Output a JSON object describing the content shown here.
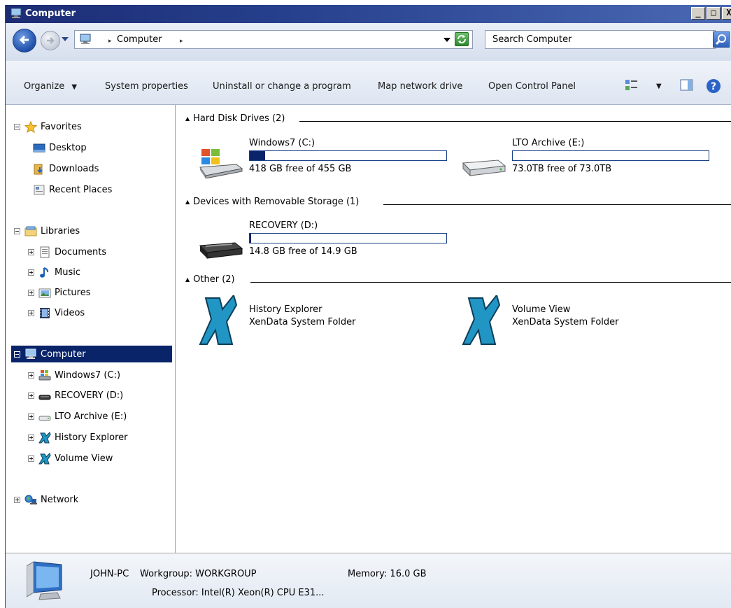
{
  "window": {
    "title": "Computer"
  },
  "title_buttons": {
    "minimize": "_",
    "maximize": "□",
    "close": "X"
  },
  "address": {
    "location": "Computer",
    "search_placeholder": "Search Computer"
  },
  "toolbar": {
    "organize": "Organize",
    "system_properties": "System properties",
    "uninstall": "Uninstall or change a program",
    "map_drive": "Map network drive",
    "control_panel": "Open Control Panel"
  },
  "nav": {
    "favorites": {
      "label": "Favorites",
      "items": [
        "Desktop",
        "Downloads",
        "Recent Places"
      ]
    },
    "libraries": {
      "label": "Libraries",
      "items": [
        "Documents",
        "Music",
        "Pictures",
        "Videos"
      ]
    },
    "computer": {
      "label": "Computer",
      "items": [
        "Windows7 (C:)",
        "RECOVERY (D:)",
        "LTO Archive (E:)",
        "History Explorer",
        "Volume View"
      ]
    },
    "network": {
      "label": "Network"
    }
  },
  "groups": {
    "hdd": {
      "header": "Hard Disk Drives (2)",
      "drives": [
        {
          "name": "Windows7 (C:)",
          "free": "418 GB free of 455 GB",
          "used_fraction": 0.08
        },
        {
          "name": "LTO Archive (E:)",
          "free": "73.0TB free of 73.0TB",
          "used_fraction": 0.0
        }
      ]
    },
    "removable": {
      "header": "Devices with Removable Storage (1)",
      "drives": [
        {
          "name": "RECOVERY (D:)",
          "free": "14.8 GB free of 14.9 GB",
          "used_fraction": 0.007
        }
      ]
    },
    "other": {
      "header": "Other (2)",
      "items": [
        {
          "name": "History Explorer",
          "type": "XenData System Folder"
        },
        {
          "name": "Volume View",
          "type": "XenData System Folder"
        }
      ]
    }
  },
  "details": {
    "computer_name": "JOHN-PC",
    "workgroup": "Workgroup: WORKGROUP",
    "memory": "Memory: 16.0 GB",
    "processor": "Processor: Intel(R) Xeon(R) CPU E31..."
  },
  "colors": {
    "selection": "#0a246a",
    "xen_icon": "#2196c4",
    "title_bar": "#1c2c74"
  }
}
